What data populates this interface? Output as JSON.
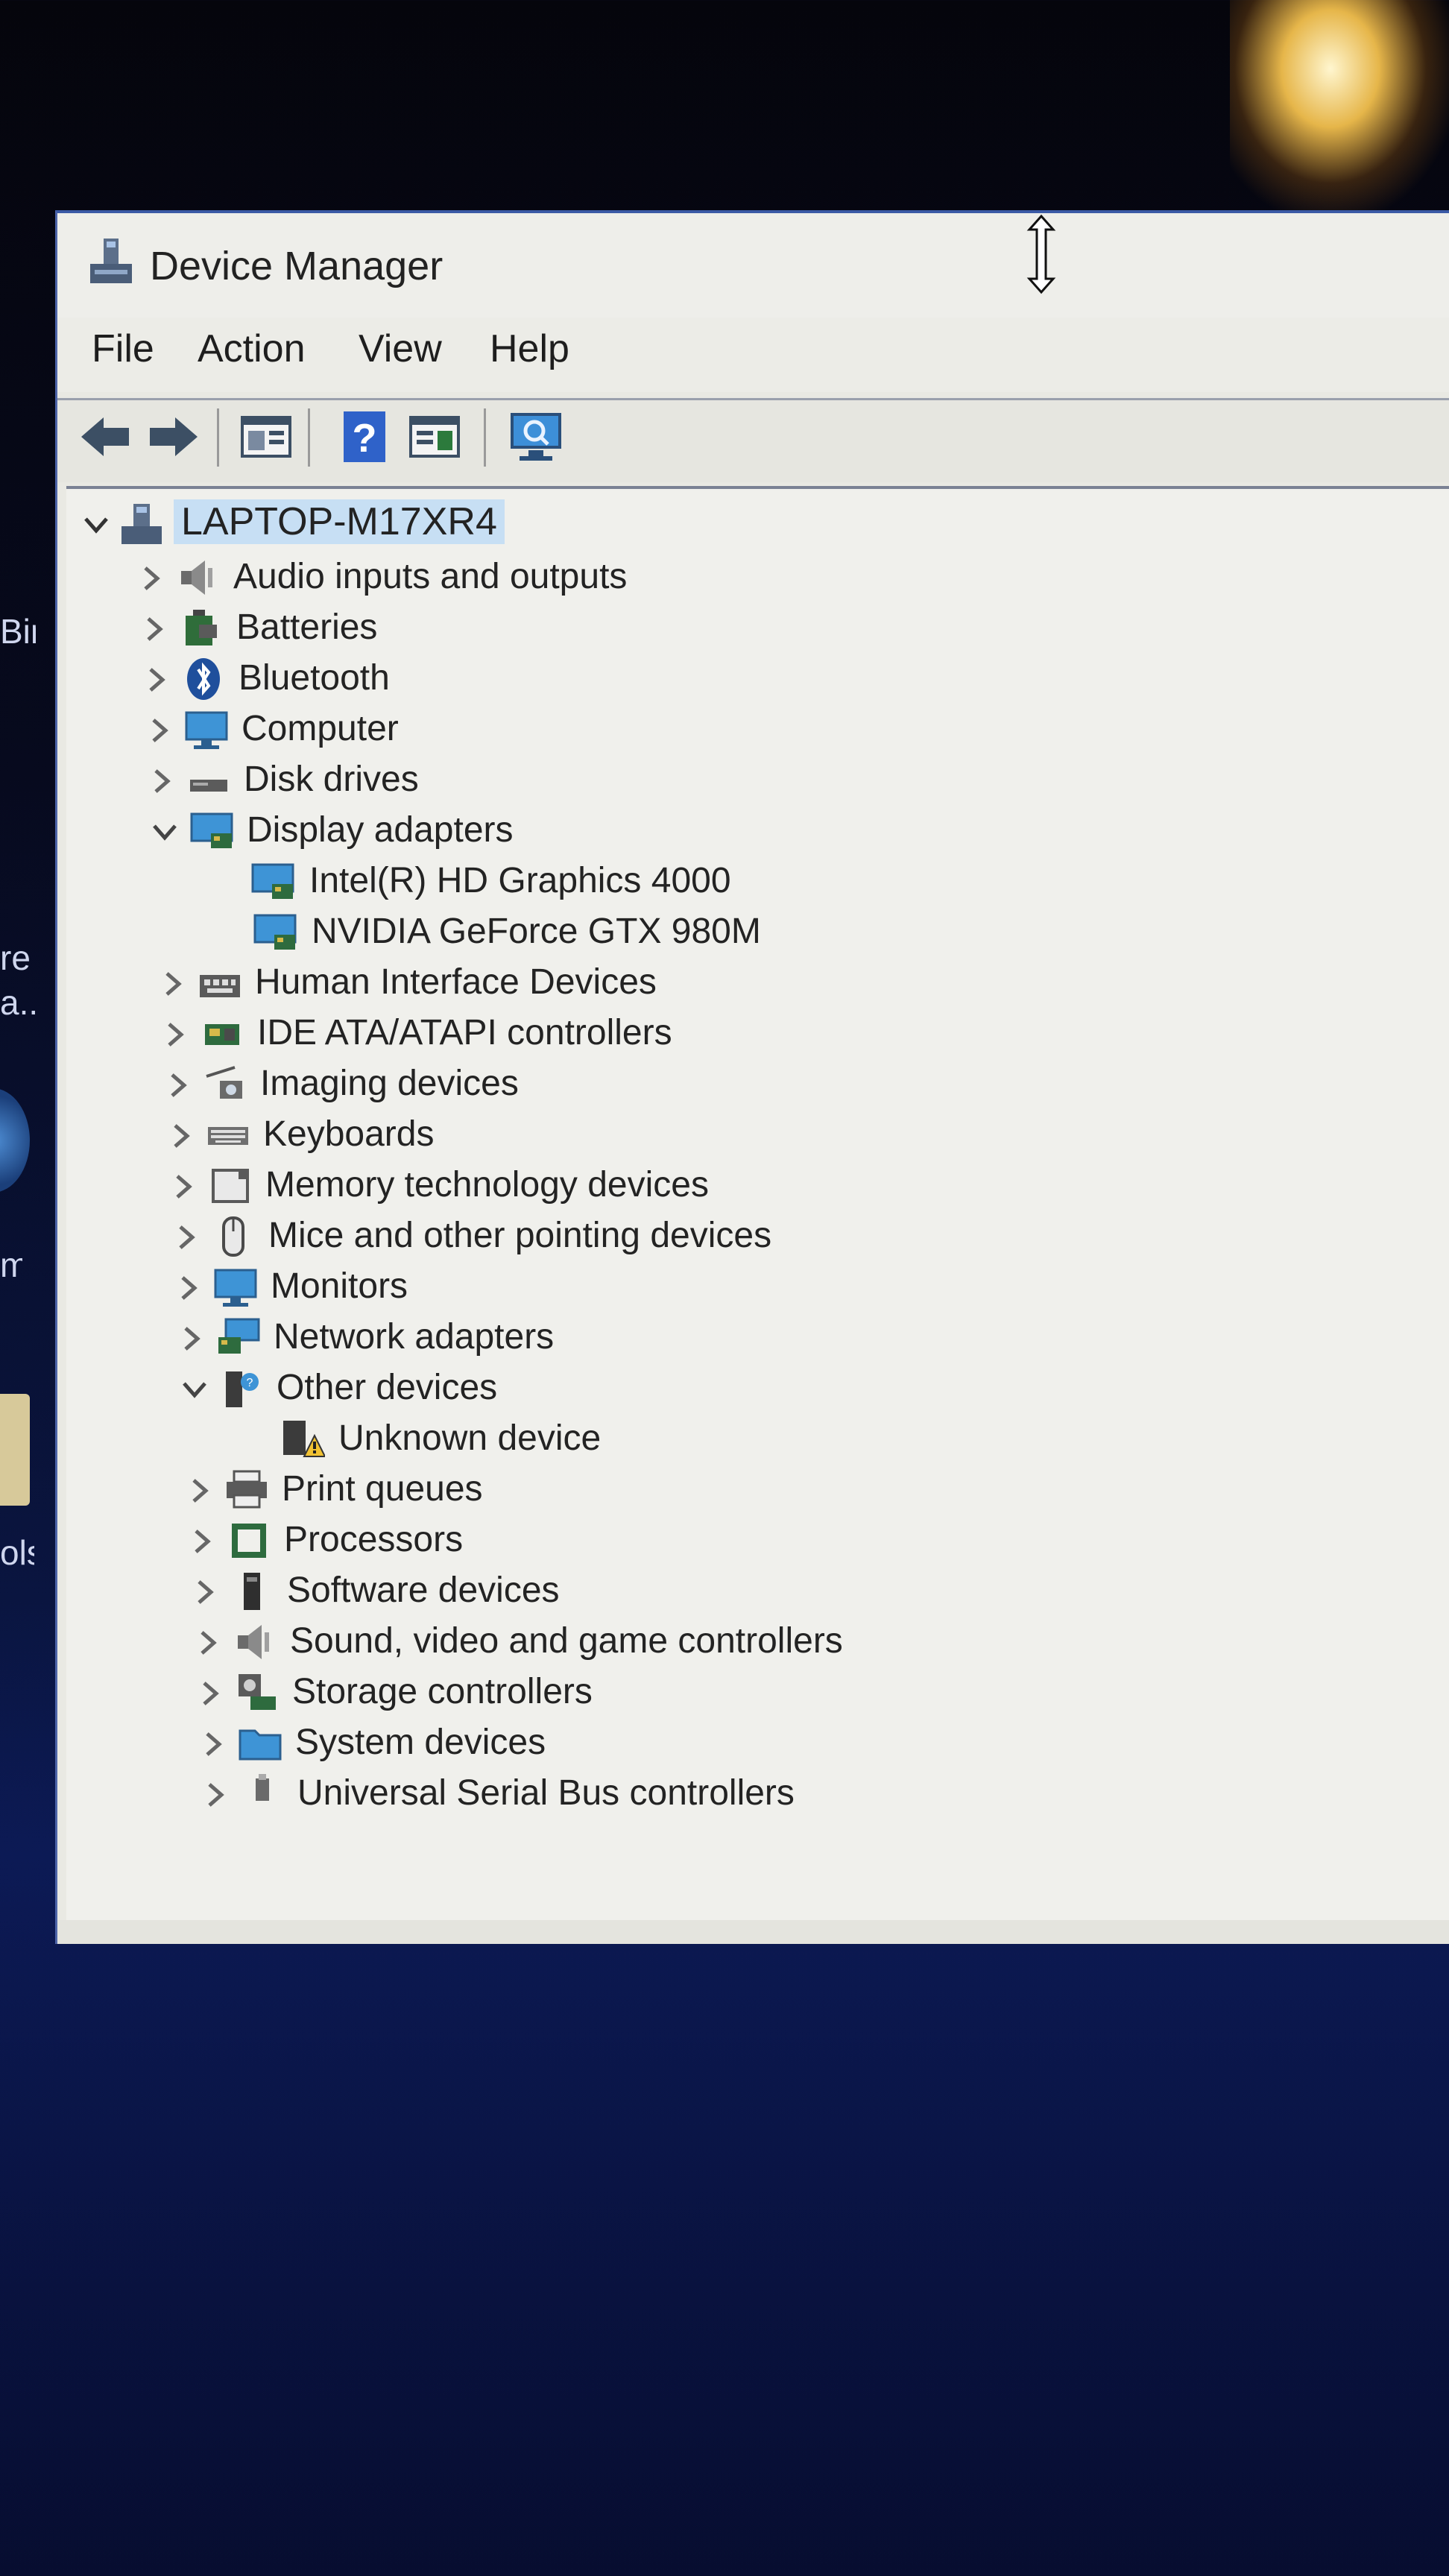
{
  "desktop": {
    "labels": [
      "Bin",
      "re",
      "a...",
      "m",
      "ols"
    ]
  },
  "window": {
    "title": "Device Manager",
    "menu": [
      "File",
      "Action",
      "View",
      "Help"
    ],
    "toolbar_icons": [
      "back-arrow-icon",
      "forward-arrow-icon",
      "properties-icon",
      "help-icon",
      "update-driver-icon",
      "scan-hardware-icon"
    ]
  },
  "tree": {
    "root": "LAPTOP-M17XR4",
    "categories": [
      {
        "label": "Audio inputs and outputs",
        "expanded": false,
        "icon": "speaker-icon"
      },
      {
        "label": "Batteries",
        "expanded": false,
        "icon": "battery-icon"
      },
      {
        "label": "Bluetooth",
        "expanded": false,
        "icon": "bluetooth-icon"
      },
      {
        "label": "Computer",
        "expanded": false,
        "icon": "monitor-icon"
      },
      {
        "label": "Disk drives",
        "expanded": false,
        "icon": "disk-drive-icon"
      },
      {
        "label": "Display adapters",
        "expanded": true,
        "icon": "display-adapter-icon",
        "children": [
          "Intel(R) HD Graphics 4000",
          "NVIDIA GeForce GTX 980M"
        ]
      },
      {
        "label": "Human Interface Devices",
        "expanded": false,
        "icon": "hid-icon"
      },
      {
        "label": "IDE ATA/ATAPI controllers",
        "expanded": false,
        "icon": "ide-controller-icon"
      },
      {
        "label": "Imaging devices",
        "expanded": false,
        "icon": "camera-icon"
      },
      {
        "label": "Keyboards",
        "expanded": false,
        "icon": "keyboard-icon"
      },
      {
        "label": "Memory technology devices",
        "expanded": false,
        "icon": "memory-card-icon"
      },
      {
        "label": "Mice and other pointing devices",
        "expanded": false,
        "icon": "mouse-icon"
      },
      {
        "label": "Monitors",
        "expanded": false,
        "icon": "monitor-icon"
      },
      {
        "label": "Network adapters",
        "expanded": false,
        "icon": "network-adapter-icon"
      },
      {
        "label": "Other devices",
        "expanded": true,
        "icon": "other-devices-icon",
        "children": [
          "Unknown device"
        ]
      },
      {
        "label": "Print queues",
        "expanded": false,
        "icon": "printer-icon"
      },
      {
        "label": "Processors",
        "expanded": false,
        "icon": "processor-icon"
      },
      {
        "label": "Software devices",
        "expanded": false,
        "icon": "software-device-icon"
      },
      {
        "label": "Sound, video and game controllers",
        "expanded": false,
        "icon": "speaker-icon"
      },
      {
        "label": "Storage controllers",
        "expanded": false,
        "icon": "storage-controller-icon"
      },
      {
        "label": "System devices",
        "expanded": false,
        "icon": "folder-icon"
      },
      {
        "label": "Universal Serial Bus controllers",
        "expanded": false,
        "icon": "usb-icon"
      }
    ]
  }
}
